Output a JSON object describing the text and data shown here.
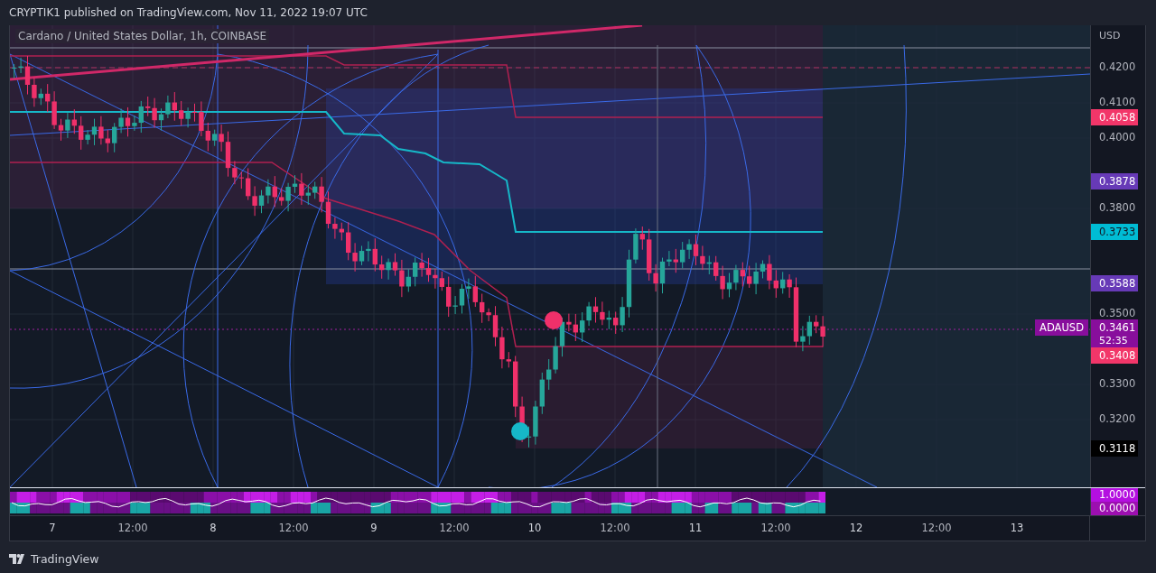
{
  "header": {
    "text": "CRYPTIK1 published on TradingView.com, Nov 11, 2022 19:07 UTC"
  },
  "chart": {
    "title": "Cardano / United States Dollar, 1h, COINBASE",
    "price_axis": {
      "currency": "USD",
      "ticks": [
        "0.4200",
        "0.4100",
        "0.4000",
        "0.3800",
        "0.3500",
        "0.3300",
        "0.3200"
      ]
    },
    "price_tags": [
      {
        "price": "0.4058",
        "color": "#f23669"
      },
      {
        "price": "0.3878",
        "color": "#673ab7"
      },
      {
        "price": "0.3733",
        "color": "#00bcd4"
      },
      {
        "price": "0.3588",
        "color": "#673ab7"
      },
      {
        "price": "0.3461",
        "color": "#880e9c",
        "countdown": "52:35",
        "symbol": "ADAUSD"
      },
      {
        "price": "0.3408",
        "color": "#f23669"
      },
      {
        "price": "0.3118",
        "color": "#000000"
      }
    ]
  },
  "indicator": {
    "tags": [
      {
        "value": "1.0000",
        "color": "#b40fe0"
      },
      {
        "value": "0.0000",
        "color": "#9c0fb0"
      }
    ]
  },
  "time_axis": {
    "labels": [
      "7",
      "12:00",
      "8",
      "12:00",
      "9",
      "12:00",
      "10",
      "12:00",
      "11",
      "12:00",
      "12",
      "12:00",
      "13"
    ]
  },
  "footer": {
    "brand": "TradingView"
  }
}
